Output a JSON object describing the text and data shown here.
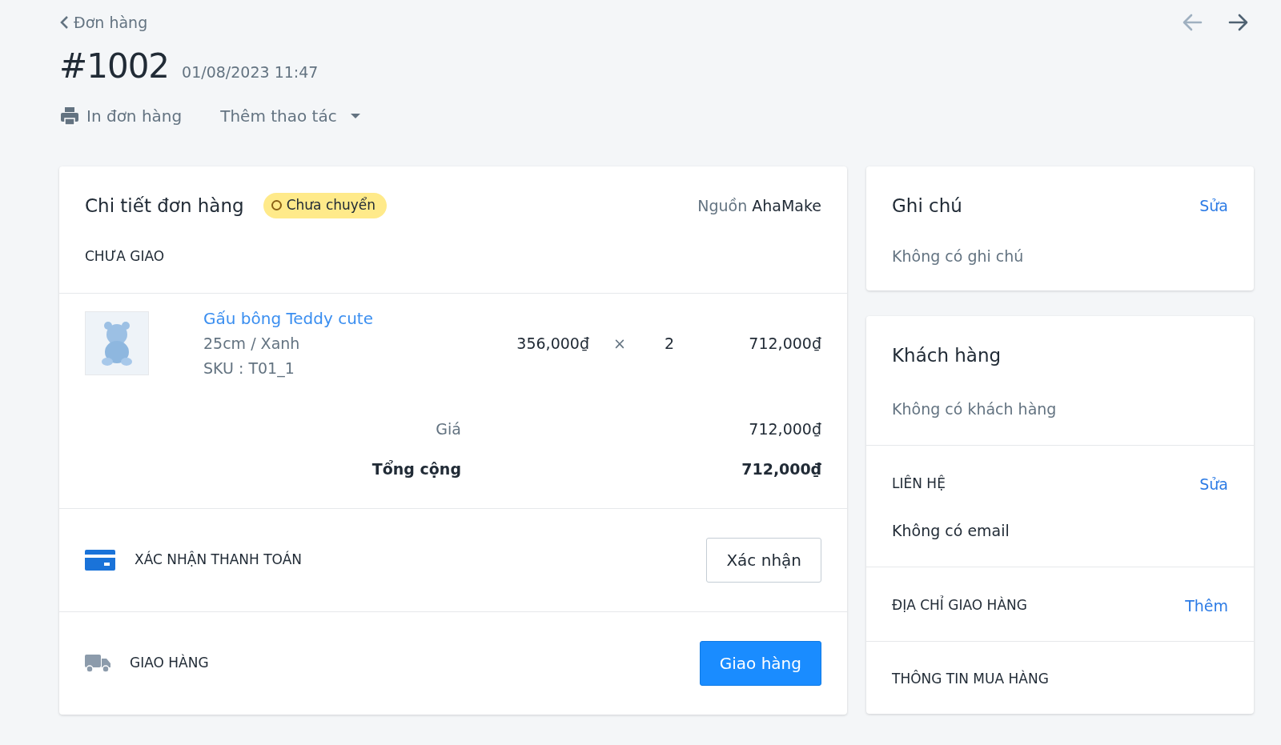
{
  "back_link": "Đơn hàng",
  "nav_arrows": [
    {
      "kind": "prev",
      "disabled": true
    },
    {
      "kind": "next",
      "disabled": false
    }
  ],
  "order": {
    "number": "#1002",
    "date": "01/08/2023 11:47"
  },
  "actions": [
    {
      "kind": "print",
      "label": "In đơn hàng"
    },
    {
      "kind": "dropdown",
      "label": "Thêm thao tác"
    }
  ],
  "order_details": {
    "title": "Chi tiết đơn hàng",
    "status_badge": "Chưa chuyển",
    "source_label": "Nguồn",
    "source": "AhaMake",
    "section": "CHƯA GIAO",
    "items": [
      {
        "name": "Gấu bông Teddy cute",
        "variant": "25cm / Xanh",
        "sku": "SKU : T01_1",
        "price": "356,000₫",
        "times": "×",
        "quantity": "2",
        "total": "712,000₫"
      }
    ],
    "summary": [
      {
        "label": "Giá",
        "value": "712,000₫",
        "bold": false
      },
      {
        "label": "Tổng cộng",
        "value": "712,000₫",
        "bold": true
      }
    ]
  },
  "steps": [
    {
      "kind": "payment",
      "label": "XÁC NHẬN THANH TOÁN",
      "button": "Xác nhận",
      "primary": false
    },
    {
      "kind": "shipping",
      "label": "GIAO HÀNG",
      "button": "Giao hàng",
      "primary": true
    }
  ],
  "notes": {
    "title": "Ghi chú",
    "action": "Sửa",
    "text": "Không có ghi chú"
  },
  "customer": {
    "title": "Khách hàng",
    "text": "Không có khách hàng",
    "sections": [
      {
        "title": "LIÊN HỆ",
        "action": "Sửa",
        "text": "Không có email"
      },
      {
        "title": "ĐỊA CHỈ GIAO HÀNG",
        "action": "Thêm"
      },
      {
        "title": "THÔNG TIN MUA HÀNG"
      }
    ]
  }
}
